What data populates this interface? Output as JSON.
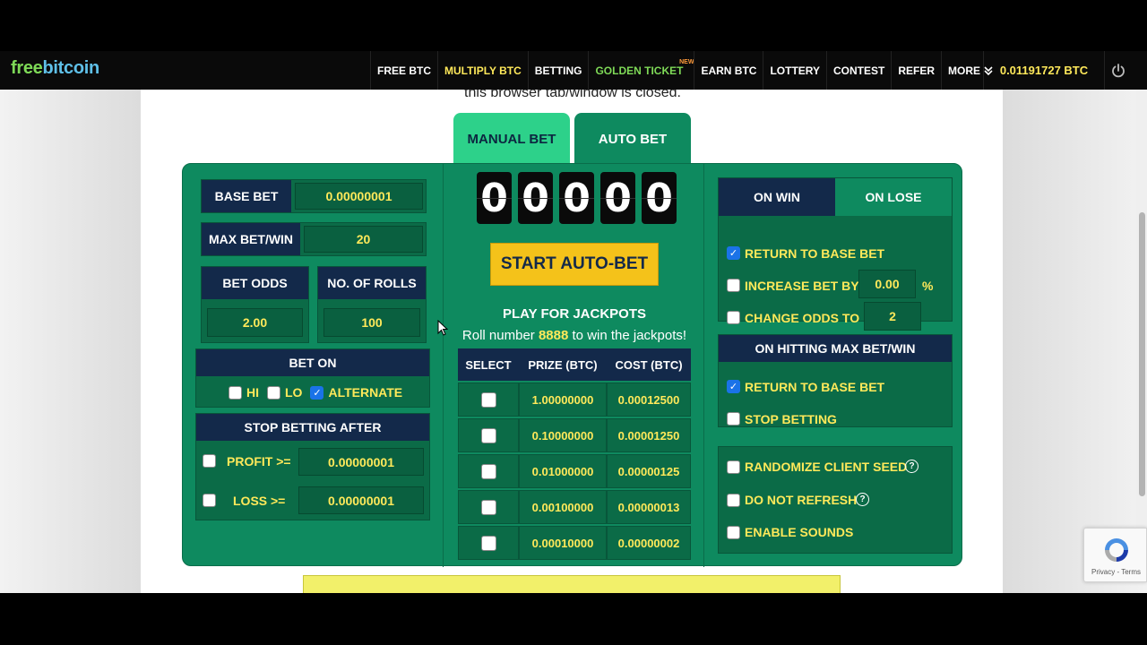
{
  "nav": {
    "logo_part1": "free",
    "logo_part2": "bitcoin",
    "items": [
      {
        "label": "FREE BTC",
        "style": "white"
      },
      {
        "label": "MULTIPLY BTC",
        "style": "yellow"
      },
      {
        "label": "BETTING",
        "style": "white"
      },
      {
        "label": "GOLDEN TICKET",
        "style": "green",
        "badge": "NEW"
      },
      {
        "label": "EARN BTC",
        "style": "white"
      },
      {
        "label": "LOTTERY",
        "style": "white"
      },
      {
        "label": "CONTEST",
        "style": "white"
      },
      {
        "label": "REFER",
        "style": "white"
      },
      {
        "label": "MORE",
        "style": "white",
        "icon": "double-chevron-down-icon"
      }
    ],
    "balance": "0.01191727 BTC",
    "power_icon": "power-icon"
  },
  "intro_text": "this browser tab/window is closed.",
  "tabs": {
    "manual": "MANUAL BET",
    "auto": "AUTO BET"
  },
  "left": {
    "base_bet_label": "BASE BET",
    "base_bet_value": "0.00000001",
    "max_bet_label": "MAX BET/WIN",
    "max_bet_value": "20",
    "bet_odds_label": "BET ODDS",
    "bet_odds_value": "2.00",
    "rolls_label": "NO. OF ROLLS",
    "rolls_value": "100",
    "bet_on_title": "BET ON",
    "bet_on": {
      "hi": {
        "label": "HI",
        "checked": false
      },
      "lo": {
        "label": "LO",
        "checked": false
      },
      "alternate": {
        "label": "ALTERNATE",
        "checked": true
      }
    },
    "stop_title": "STOP BETTING AFTER",
    "profit_label": "PROFIT >=",
    "profit_value": "0.00000001",
    "loss_label": "LOSS >=",
    "loss_value": "0.00000001"
  },
  "middle": {
    "digits": [
      "0",
      "0",
      "0",
      "0",
      "0"
    ],
    "start_button": "START AUTO-BET",
    "jackpot_title": "PLAY FOR JACKPOTS",
    "jackpot_sub_pre": "Roll number ",
    "jackpot_number": "8888",
    "jackpot_sub_post": " to win the jackpots!",
    "table_headers": [
      "SELECT",
      "PRIZE (BTC)",
      "COST (BTC)"
    ],
    "rows": [
      {
        "prize": "1.00000000",
        "cost": "0.00012500"
      },
      {
        "prize": "0.10000000",
        "cost": "0.00001250"
      },
      {
        "prize": "0.01000000",
        "cost": "0.00000125"
      },
      {
        "prize": "0.00100000",
        "cost": "0.00000013"
      },
      {
        "prize": "0.00010000",
        "cost": "0.00000002"
      }
    ]
  },
  "right": {
    "on_win_tab": "ON WIN",
    "on_lose_tab": "ON LOSE",
    "return_base": "RETURN TO BASE BET",
    "increase_label": "INCREASE BET BY",
    "increase_value": "0.00",
    "increase_unit": "%",
    "change_odds_label": "CHANGE ODDS TO",
    "change_odds_value": "2",
    "max_hit_title": "ON HITTING MAX BET/WIN",
    "max_return_base": "RETURN TO BASE BET",
    "stop_betting": "STOP BETTING",
    "randomize_seed": "RANDOMIZE CLIENT SEED",
    "do_not_refresh": "DO NOT REFRESH",
    "enable_sounds": "ENABLE SOUNDS",
    "help_glyph": "?"
  },
  "recaptcha": {
    "text": "Privacy - Terms"
  },
  "colors": {
    "panel_green": "#0e8a5f",
    "navy": "#13294a",
    "accent_yellow": "#ffe95a",
    "button_yellow": "#f4c21a",
    "tab_light_green": "#2dd18a"
  }
}
